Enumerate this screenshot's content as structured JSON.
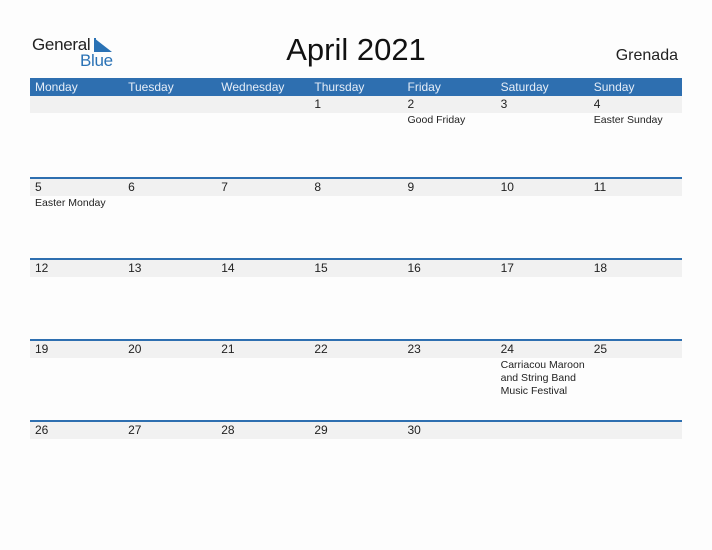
{
  "logo": {
    "word1": "General",
    "word2": "Blue"
  },
  "title": "April 2021",
  "country": "Grenada",
  "accent_color": "#2e6fb0",
  "weekdays": [
    "Monday",
    "Tuesday",
    "Wednesday",
    "Thursday",
    "Friday",
    "Saturday",
    "Sunday"
  ],
  "weeks": [
    [
      {
        "day": "",
        "event": ""
      },
      {
        "day": "",
        "event": ""
      },
      {
        "day": "",
        "event": ""
      },
      {
        "day": "1",
        "event": ""
      },
      {
        "day": "2",
        "event": "Good Friday"
      },
      {
        "day": "3",
        "event": ""
      },
      {
        "day": "4",
        "event": "Easter Sunday"
      }
    ],
    [
      {
        "day": "5",
        "event": "Easter Monday"
      },
      {
        "day": "6",
        "event": ""
      },
      {
        "day": "7",
        "event": ""
      },
      {
        "day": "8",
        "event": ""
      },
      {
        "day": "9",
        "event": ""
      },
      {
        "day": "10",
        "event": ""
      },
      {
        "day": "11",
        "event": ""
      }
    ],
    [
      {
        "day": "12",
        "event": ""
      },
      {
        "day": "13",
        "event": ""
      },
      {
        "day": "14",
        "event": ""
      },
      {
        "day": "15",
        "event": ""
      },
      {
        "day": "16",
        "event": ""
      },
      {
        "day": "17",
        "event": ""
      },
      {
        "day": "18",
        "event": ""
      }
    ],
    [
      {
        "day": "19",
        "event": ""
      },
      {
        "day": "20",
        "event": ""
      },
      {
        "day": "21",
        "event": ""
      },
      {
        "day": "22",
        "event": ""
      },
      {
        "day": "23",
        "event": ""
      },
      {
        "day": "24",
        "event": "Carriacou Maroon and String Band Music Festival"
      },
      {
        "day": "25",
        "event": ""
      }
    ],
    [
      {
        "day": "26",
        "event": ""
      },
      {
        "day": "27",
        "event": ""
      },
      {
        "day": "28",
        "event": ""
      },
      {
        "day": "29",
        "event": ""
      },
      {
        "day": "30",
        "event": ""
      },
      {
        "day": "",
        "event": ""
      },
      {
        "day": "",
        "event": ""
      }
    ]
  ]
}
